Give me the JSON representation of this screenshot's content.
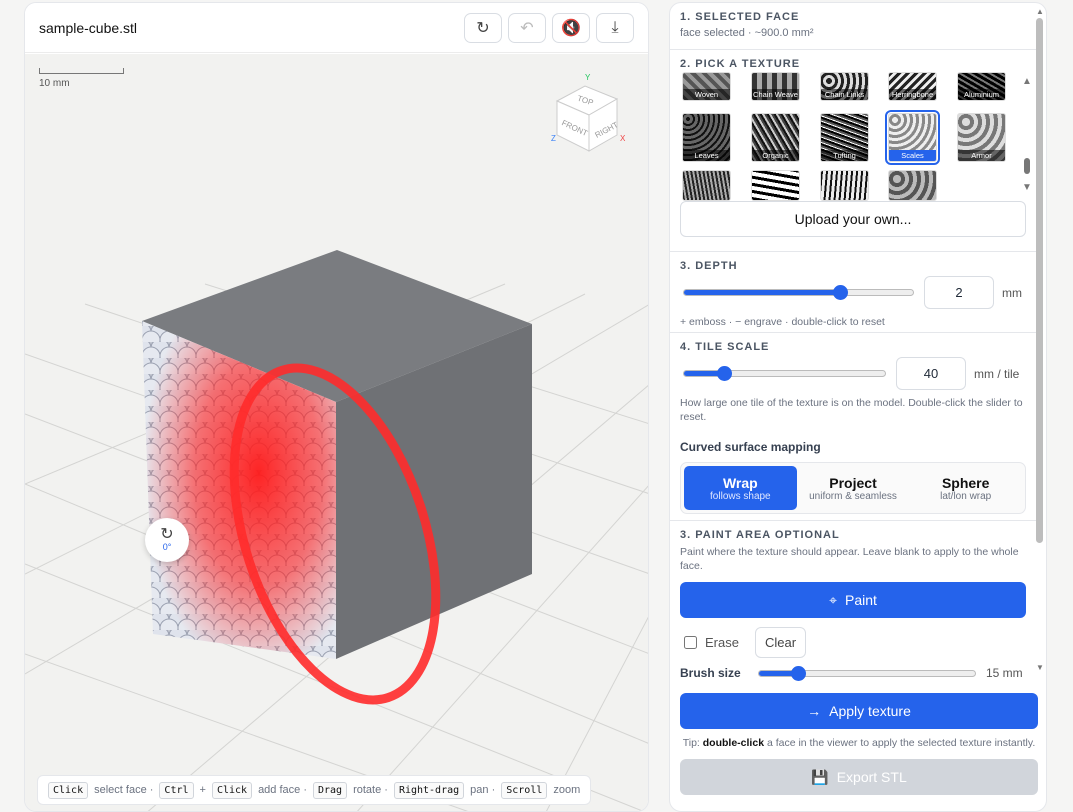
{
  "viewer": {
    "filename": "sample-cube.stl",
    "scale_label": "10 mm",
    "rotate_value": "0°",
    "axes": {
      "y": "Y",
      "x": "X",
      "z": "Z"
    },
    "cube_faces": {
      "top": "TOP",
      "front": "FRONT",
      "right": "RIGHT"
    },
    "hints": [
      {
        "key": "Click",
        "text": "select face ·"
      },
      {
        "key": "Ctrl",
        "text": "+"
      },
      {
        "key": "Click",
        "text": "add face ·"
      },
      {
        "key": "Drag",
        "text": "rotate ·"
      },
      {
        "key": "Right-drag",
        "text": "pan ·"
      },
      {
        "key": "Scroll",
        "text": "zoom"
      }
    ]
  },
  "panel": {
    "s1": {
      "title": "1. SELECTED FACE",
      "sub": "face selected · ~900.0 mm²"
    },
    "s2": {
      "title": "2. PICK A TEXTURE",
      "upload": "Upload your own...",
      "row1": [
        "Woven",
        "Chain Weave",
        "Chain Links",
        "Herringbone",
        "Aluminium"
      ],
      "row2": [
        "Leaves",
        "Organic",
        "Tufting",
        "Scales",
        "Armor"
      ]
    },
    "s3": {
      "title": "3. DEPTH",
      "value": "2",
      "unit": "mm",
      "note": "+ emboss · − engrave · double-click to reset",
      "level": 0.68
    },
    "s4": {
      "title": "4. TILE SCALE",
      "value": "40",
      "unit": "mm / tile",
      "note": "How large one tile of the texture is on the model. Double-click the slider to reset.",
      "level": 0.2,
      "mapping_label": "Curved surface mapping",
      "modes": [
        {
          "label": "Wrap",
          "sub": "follows shape"
        },
        {
          "label": "Project",
          "sub": "uniform & seamless"
        },
        {
          "label": "Sphere",
          "sub": "lat/lon wrap"
        }
      ]
    },
    "s5": {
      "title": "3. PAINT AREA OPTIONAL",
      "note": "Paint where the texture should appear. Leave blank to apply to the whole face.",
      "paint": "Paint",
      "erase": "Erase",
      "clear": "Clear",
      "brush_label": "Brush size",
      "brush_value": "15 mm",
      "brush_level": 0.18
    },
    "apply": "Apply texture",
    "tip_pre": "Tip: ",
    "tip_bold": "double-click",
    "tip_post": " a face in the viewer to apply the selected texture instantly.",
    "export": "Export STL"
  }
}
